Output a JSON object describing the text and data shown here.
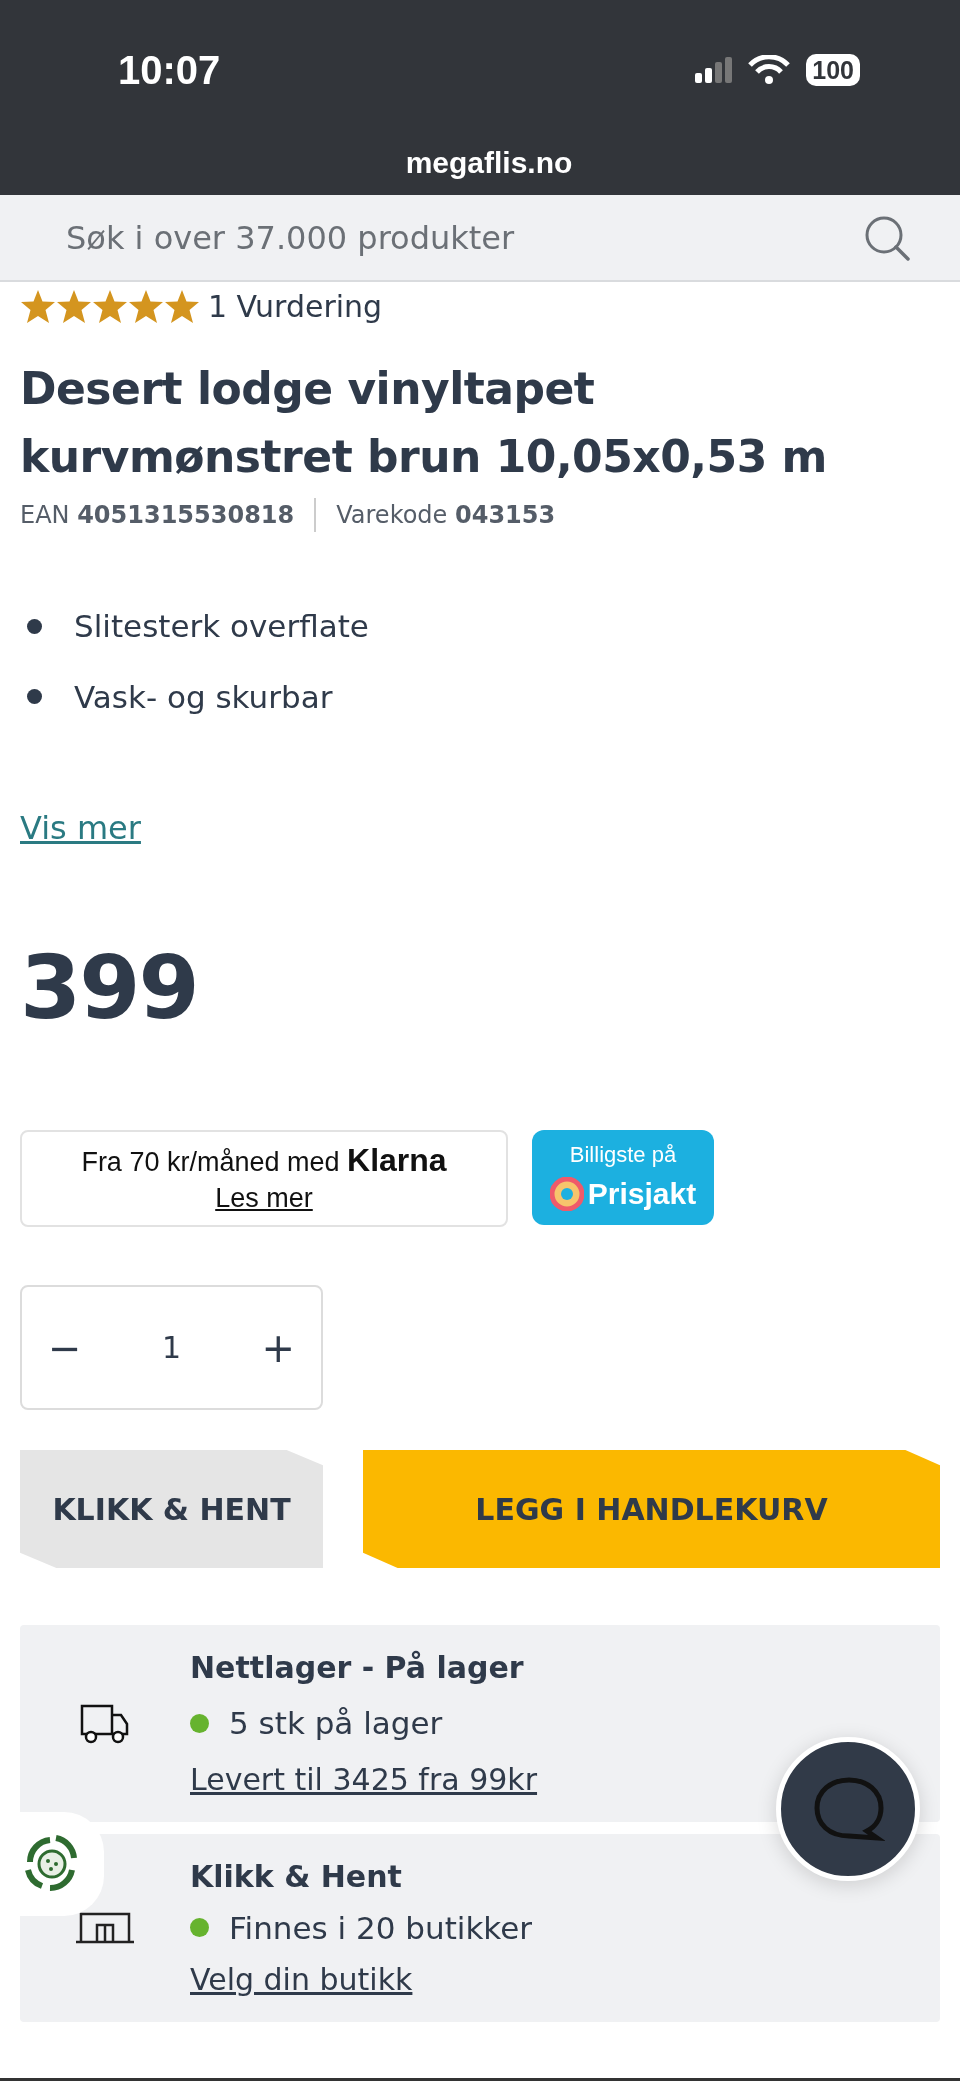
{
  "status_bar": {
    "time": "10:07",
    "battery": "100"
  },
  "browser": {
    "url": "megaflis.no"
  },
  "search": {
    "placeholder": "Søk i over 37.000 produkter"
  },
  "rating": {
    "stars": 5,
    "label": "1 Vurdering"
  },
  "product": {
    "title": "Desert lodge vinyltapet kurvmønstret brun 10,05x0,53 m",
    "codes": [
      {
        "label": "EAN",
        "value": "4051315530818"
      },
      {
        "label": "Varekode",
        "value": "043153"
      }
    ],
    "features": [
      "Slitesterk overflate",
      "Vask- og skurbar"
    ],
    "more_link": "Vis mer",
    "price": "399"
  },
  "klarna": {
    "text": "Fra 70 kr/måned med",
    "brand": "Klarna",
    "link": "Les mer"
  },
  "prisjakt": {
    "caption": "Billigste på",
    "brand": "Prisjakt"
  },
  "quantity": {
    "minus": "−",
    "value": "1",
    "plus": "+"
  },
  "buttons": [
    {
      "label": "KLIKK & HENT",
      "kind": "secondary"
    },
    {
      "label": "LEGG I HANDLEKURV",
      "kind": "primary"
    }
  ],
  "availability": [
    {
      "kind": "truck",
      "title": "Nettlager - På lager",
      "status": "5 stk på lager",
      "color": "#66b32e",
      "link": "Levert til 3425 fra 99kr"
    },
    {
      "kind": "store",
      "title": "Klikk & Hent",
      "status": "Finnes i 20 butikker",
      "color": "#66b32e",
      "link": "Velg din butikk"
    }
  ]
}
